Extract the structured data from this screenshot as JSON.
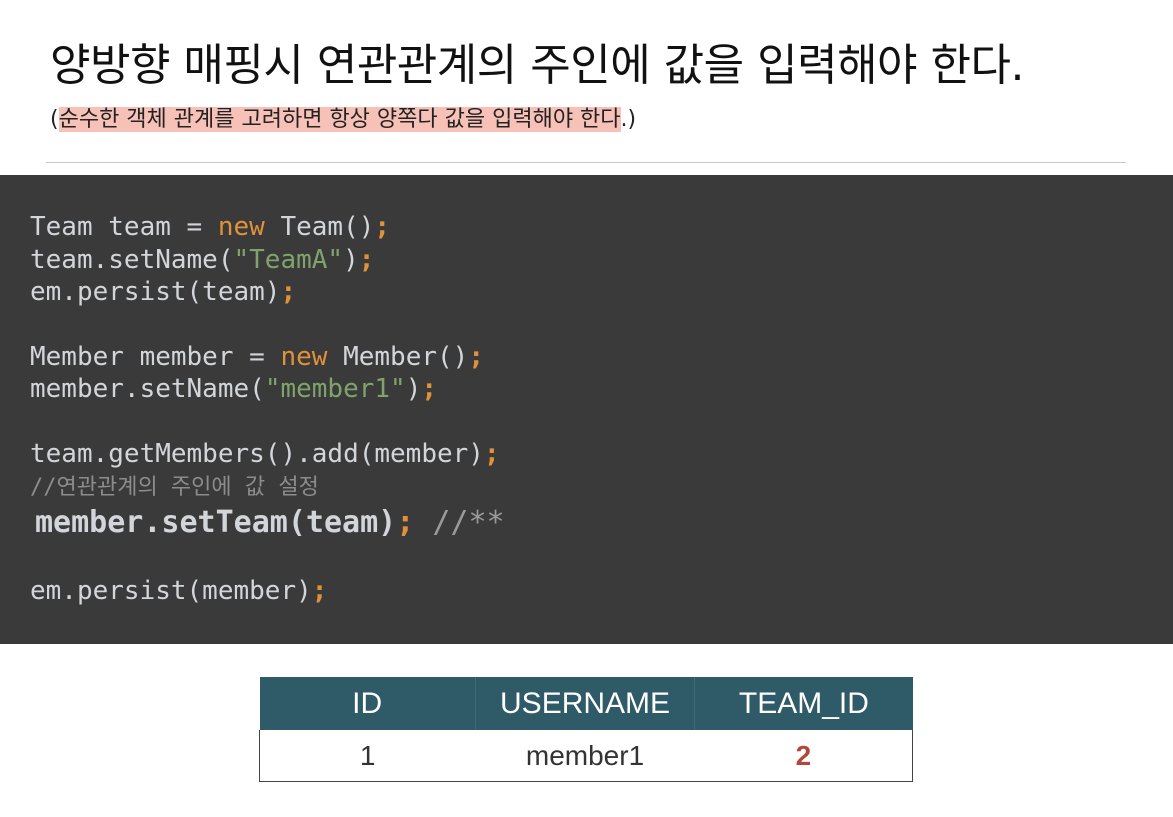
{
  "slide": {
    "title": "양방향 매핑시 연관관계의 주인에 값을 입력해야 한다.",
    "subtitle_open": "(",
    "subtitle_highlight": "순수한 객체 관계를 고려하면 항상 양쪽다 값을 입력해야 한다",
    "subtitle_close": ".)"
  },
  "code": {
    "l1": {
      "a": "Team team = ",
      "kw": "new",
      "b": " Team()",
      "semi": ";"
    },
    "l2": {
      "a": "team.setName(",
      "str": "\"TeamA\"",
      "b": ")",
      "semi": ";"
    },
    "l3": {
      "a": "em.persist(team)",
      "semi": ";"
    },
    "l4": {
      "a": "Member member = ",
      "kw": "new",
      "b": " Member()",
      "semi": ";"
    },
    "l5": {
      "a": "member.setName(",
      "str": "\"member1\"",
      "b": ")",
      "semi": ";"
    },
    "l6": {
      "a": "team.getMembers().add(member)",
      "semi": ";"
    },
    "l7": {
      "comment": "//연관관계의 주인에 값 설정"
    },
    "l8": {
      "a": "member.setTeam(team)",
      "semi": ";",
      "cm": " //**"
    },
    "l9": {
      "a": "em.persist(member)",
      "semi": ";"
    }
  },
  "table": {
    "headers": [
      "ID",
      "USERNAME",
      "TEAM_ID"
    ],
    "rows": [
      [
        "1",
        "member1",
        "2"
      ]
    ],
    "accent_color": "#b0473a",
    "header_color": "#2f5a67"
  }
}
